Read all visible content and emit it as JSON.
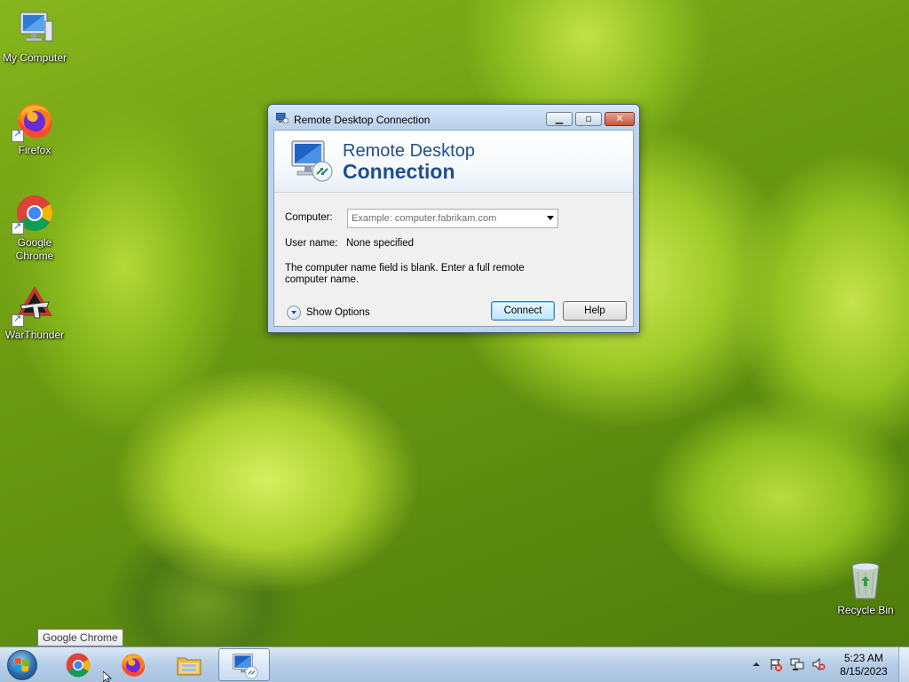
{
  "desktop": {
    "icons": [
      {
        "label": "My Computer",
        "icon": "computer-icon"
      },
      {
        "label": "Firefox",
        "icon": "firefox-icon"
      },
      {
        "label": "Google Chrome",
        "icon": "chrome-icon"
      },
      {
        "label": "WarThunder",
        "icon": "warthunder-icon"
      },
      {
        "label": "Recycle Bin",
        "icon": "recycle-bin-icon"
      }
    ]
  },
  "window": {
    "title": "Remote Desktop Connection",
    "banner_line1": "Remote Desktop",
    "banner_line2": "Connection",
    "computer_label": "Computer:",
    "computer_placeholder": "Example: computer.fabrikam.com",
    "username_label": "User name:",
    "username_value": "None specified",
    "message": "The computer name field is blank. Enter a full remote computer name.",
    "show_options": "Show Options",
    "connect": "Connect",
    "help": "Help",
    "controls": {
      "minimize": "minimize-icon",
      "maximize": "maximize-icon",
      "close": "close-icon"
    }
  },
  "taskbar": {
    "items": [
      "start-orb",
      "chrome-icon",
      "firefox-icon",
      "file-explorer-icon",
      "remote-desktop-icon"
    ],
    "tooltip": "Google Chrome",
    "clock_time": "5:23 AM",
    "clock_date": "8/15/2023",
    "tray": [
      "show-hidden-icons",
      "action-center-icon",
      "network-icon",
      "volume-muted-icon"
    ]
  }
}
